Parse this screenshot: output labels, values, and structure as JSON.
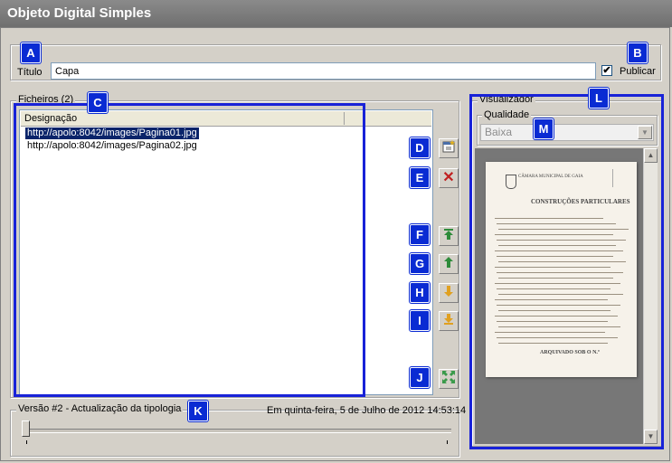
{
  "window": {
    "title": "Objeto Digital Simples"
  },
  "form": {
    "title_label": "Título",
    "title_value": "Capa",
    "publish_label": "Publicar",
    "publish_checked": true
  },
  "files": {
    "group_label": "Ficheiros (2)",
    "column_header": "Designação",
    "items": [
      {
        "label": "http://apolo:8042/images/Pagina01.jpg",
        "selected": true
      },
      {
        "label": "http://apolo:8042/images/Pagina02.jpg",
        "selected": false
      }
    ]
  },
  "toolbar": {
    "add": "add-file-icon",
    "delete": "delete-icon",
    "move_top": "move-top-icon",
    "move_up": "move-up-icon",
    "move_down": "move-down-icon",
    "move_bottom": "move-bottom-icon",
    "expand": "expand-icon"
  },
  "version": {
    "label": "Versão #2 - Actualização da tipologia",
    "date": "Em quinta-feira, 5 de Julho de 2012 14:53:14",
    "slider_position": 0
  },
  "viewer": {
    "group_label": "Visualizador",
    "quality_label": "Qualidade",
    "quality_value": "Baixa",
    "document": {
      "header": "CÂMARA MUNICIPAL DE GAIA",
      "heading": "CONSTRUÇÕES PARTICULARES",
      "footer": "ARQUIVADO SOB O N.º"
    }
  },
  "annotations": [
    "A",
    "B",
    "C",
    "D",
    "E",
    "F",
    "G",
    "H",
    "I",
    "J",
    "K",
    "L",
    "M"
  ],
  "colors": {
    "annotation_blue": "#1822d8",
    "selection": "#0a246a",
    "titlebar": "#7a7a7a"
  }
}
